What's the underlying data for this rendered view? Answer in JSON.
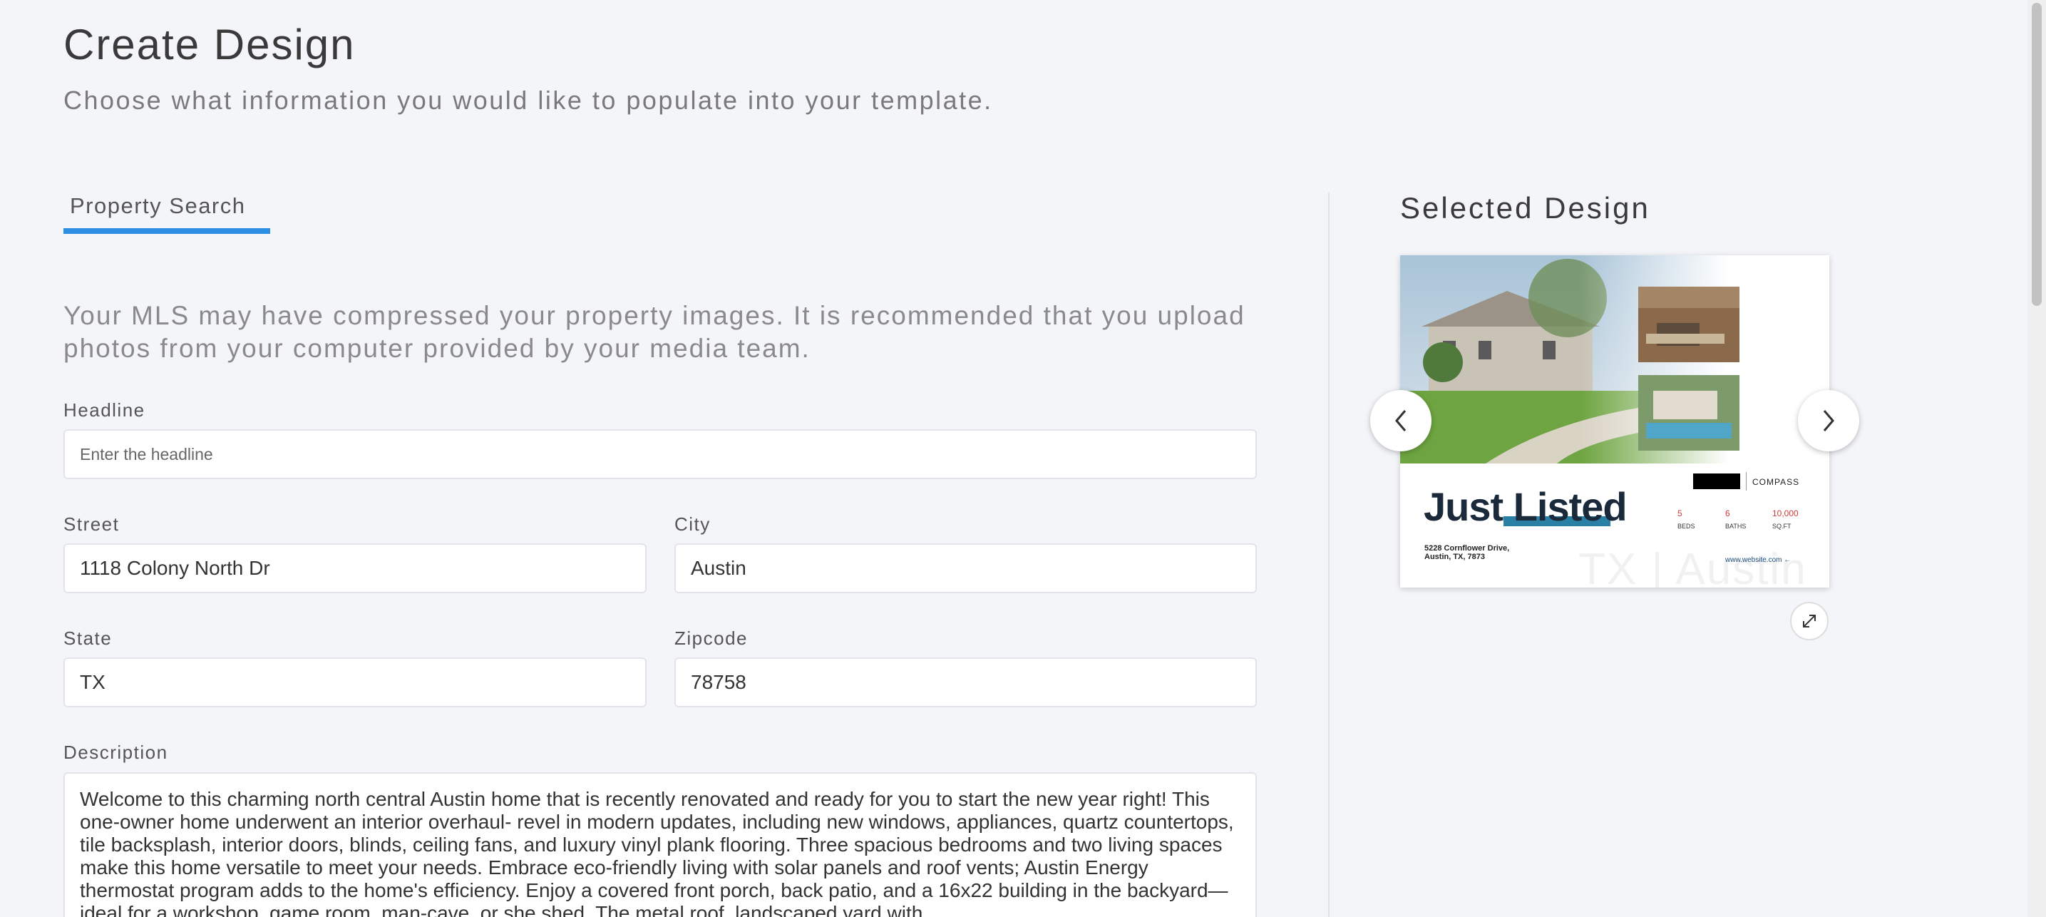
{
  "header": {
    "title": "Create Design",
    "subtitle": "Choose what information you would like to populate into your template."
  },
  "tabs": [
    {
      "label": "Property Search",
      "active": true
    }
  ],
  "notice": "Your MLS may have compressed your property images. It is recommended that you upload photos from your computer provided by your media team.",
  "form": {
    "headline": {
      "label": "Headline",
      "value": "",
      "placeholder": "Enter the headline"
    },
    "street": {
      "label": "Street",
      "value": "1118 Colony North Dr"
    },
    "city": {
      "label": "City",
      "value": "Austin"
    },
    "state": {
      "label": "State",
      "value": "TX"
    },
    "zipcode": {
      "label": "Zipcode",
      "value": "78758"
    },
    "description": {
      "label": "Description",
      "value": "Welcome to this charming north central Austin home that is recently renovated and ready for you to start the new year right! This one-owner home underwent an interior overhaul- revel in modern updates, including new windows, appliances, quartz countertops, tile backsplash, interior doors, blinds, ceiling fans, and luxury vinyl plank flooring. Three spacious bedrooms and two living spaces make this home versatile to meet your needs. Embrace eco-friendly living with solar panels and roof vents; Austin Energy thermostat program adds to the home's efficiency. Enjoy a covered front porch, back patio,  and a 16x22 building in the backyard—ideal for a workshop, game room, man-cave, or she shed. The metal roof, landscaped yard with"
    }
  },
  "selected_design": {
    "title": "Selected Design",
    "flyer": {
      "headline": "Just Listed",
      "address_line1": "5228 Cornflower Drive,",
      "address_line2": "Austin, TX, 7873",
      "brand": "COMPASS",
      "stats": [
        {
          "value": "5",
          "label": "BEDS"
        },
        {
          "value": "6",
          "label": "BATHS"
        },
        {
          "value": "10,000",
          "label": "SQ.FT"
        }
      ],
      "website": "www.website.com",
      "watermark": "TX | Austin"
    }
  },
  "colors": {
    "accent": "#2b8ee0",
    "background": "#f4f5f9",
    "flyer_highlight": "#2a7fa5",
    "flyer_stat": "#d23b3b"
  },
  "icons": [
    "chevron-left-icon",
    "chevron-right-icon",
    "expand-icon"
  ]
}
